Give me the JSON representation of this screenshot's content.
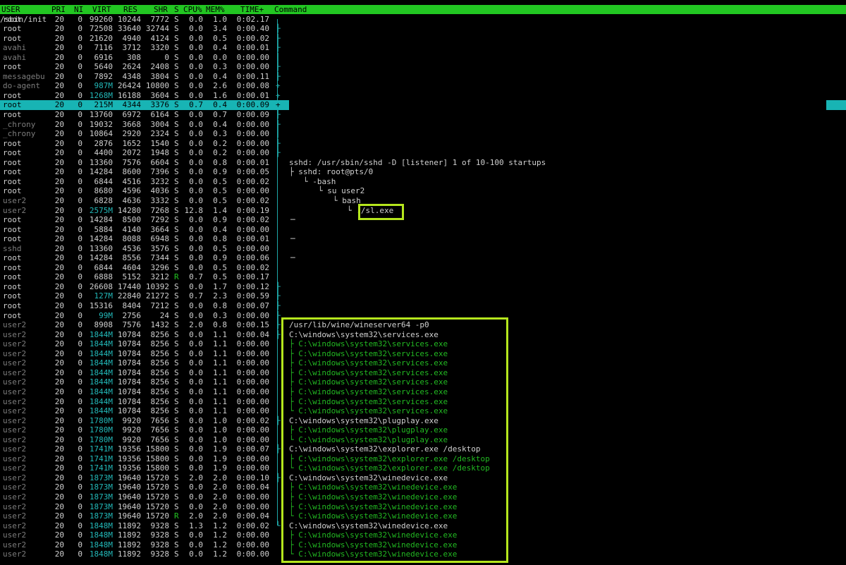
{
  "header": {
    "user": "USER",
    "pri": "PRI",
    "ni": "NI",
    "virt": "VIRT",
    "res": "RES",
    "shr": "SHR",
    "s": "S",
    "cpu": "CPU%",
    "mem": "MEM%",
    "time": "TIME+",
    "command": "Command"
  },
  "rows": [
    {
      "user": "root",
      "pri": "20",
      "ni": "0",
      "virt": "99260",
      "res": "10244",
      "shr": "7772",
      "s": "S",
      "cpu": "0.0",
      "mem": "1.0",
      "time": "0:02.17",
      "tree": "",
      "cmd": "/sbin/init",
      "cmdx": 0
    },
    {
      "user": "root",
      "pri": "20",
      "ni": "0",
      "virt": "72508",
      "res": "33640",
      "shr": "32744",
      "s": "S",
      "cpu": "0.0",
      "mem": "3.4",
      "time": "0:00.40",
      "tree": "├",
      "cmd": "",
      "cmdx": 0
    },
    {
      "user": "root",
      "pri": "20",
      "ni": "0",
      "virt": "21620",
      "res": "4940",
      "shr": "4124",
      "s": "S",
      "cpu": "0.0",
      "mem": "0.5",
      "time": "0:00.02",
      "tree": "├",
      "cmd": "",
      "cmdx": 0
    },
    {
      "user": "avahi",
      "pri": "20",
      "ni": "0",
      "virt": "7116",
      "res": "3712",
      "shr": "3320",
      "s": "S",
      "cpu": "0.0",
      "mem": "0.4",
      "time": "0:00.01",
      "tree": "├",
      "cmd": "",
      "cmdx": 0
    },
    {
      "user": "avahi",
      "pri": "20",
      "ni": "0",
      "virt": "6916",
      "res": "308",
      "shr": "0",
      "s": "S",
      "cpu": "0.0",
      "mem": "0.0",
      "time": "0:00.00",
      "tree": "│",
      "cmd": "",
      "cmdx": 0
    },
    {
      "user": "root",
      "pri": "20",
      "ni": "0",
      "virt": "5640",
      "res": "2624",
      "shr": "2408",
      "s": "S",
      "cpu": "0.0",
      "mem": "0.3",
      "time": "0:00.00",
      "tree": "├",
      "cmd": "",
      "cmdx": 0
    },
    {
      "user": "messagebu",
      "pri": "20",
      "ni": "0",
      "virt": "7892",
      "res": "4348",
      "shr": "3804",
      "s": "S",
      "cpu": "0.0",
      "mem": "0.4",
      "time": "0:00.11",
      "tree": "├",
      "cmd": "",
      "cmdx": 0
    },
    {
      "user": "do-agent",
      "pri": "20",
      "ni": "0",
      "virt": "987M",
      "res": "26424",
      "shr": "10800",
      "s": "S",
      "cpu": "0.0",
      "mem": "2.6",
      "time": "0:00.08",
      "tree": "+",
      "cmd": "",
      "cmdx": 0
    },
    {
      "user": "root",
      "pri": "20",
      "ni": "0",
      "virt": "1268M",
      "res": "16188",
      "shr": "3604",
      "s": "S",
      "cpu": "0.0",
      "mem": "1.6",
      "time": "0:00.01",
      "tree": "+",
      "cmd": "",
      "cmdx": 0
    },
    {
      "user": "root",
      "pri": "20",
      "ni": "0",
      "virt": "215M",
      "res": "4344",
      "shr": "3376",
      "s": "S",
      "cpu": "0.7",
      "mem": "0.4",
      "time": "0:00.09",
      "tree": "+",
      "cmd": "",
      "cmdx": 0,
      "sel": true
    },
    {
      "user": "root",
      "pri": "20",
      "ni": "0",
      "virt": "13760",
      "res": "6972",
      "shr": "6164",
      "s": "S",
      "cpu": "0.0",
      "mem": "0.7",
      "time": "0:00.09",
      "tree": "├",
      "cmd": "",
      "cmdx": 0
    },
    {
      "user": "_chrony",
      "pri": "20",
      "ni": "0",
      "virt": "19032",
      "res": "3668",
      "shr": "3004",
      "s": "S",
      "cpu": "0.0",
      "mem": "0.4",
      "time": "0:00.00",
      "tree": "├",
      "cmd": "",
      "cmdx": 0
    },
    {
      "user": "_chrony",
      "pri": "20",
      "ni": "0",
      "virt": "10864",
      "res": "2920",
      "shr": "2324",
      "s": "S",
      "cpu": "0.0",
      "mem": "0.3",
      "time": "0:00.00",
      "tree": "│",
      "cmd": "",
      "cmdx": 0
    },
    {
      "user": "root",
      "pri": "20",
      "ni": "0",
      "virt": "2876",
      "res": "1652",
      "shr": "1540",
      "s": "S",
      "cpu": "0.0",
      "mem": "0.2",
      "time": "0:00.00",
      "tree": "├",
      "cmd": "",
      "cmdx": 0
    },
    {
      "user": "root",
      "pri": "20",
      "ni": "0",
      "virt": "4400",
      "res": "2072",
      "shr": "1948",
      "s": "S",
      "cpu": "0.0",
      "mem": "0.2",
      "time": "0:00.00",
      "tree": "├",
      "cmd": "",
      "cmdx": 0
    },
    {
      "user": "root",
      "pri": "20",
      "ni": "0",
      "virt": "13360",
      "res": "7576",
      "shr": "6604",
      "s": "S",
      "cpu": "0.0",
      "mem": "0.8",
      "time": "0:00.01",
      "tree": "",
      "cmd": "sshd: /usr/sbin/sshd -D [listener] 1 of 10-100 startups",
      "cmdx": 410
    },
    {
      "user": "root",
      "pri": "20",
      "ni": "0",
      "virt": "14284",
      "res": "8600",
      "shr": "7396",
      "s": "S",
      "cpu": "0.0",
      "mem": "0.9",
      "time": "0:00.05",
      "tree": "",
      "cmd": "├ sshd: root@pts/0",
      "cmdx": 410
    },
    {
      "user": "root",
      "pri": "20",
      "ni": "0",
      "virt": "6844",
      "res": "4516",
      "shr": "3232",
      "s": "S",
      "cpu": "0.0",
      "mem": "0.5",
      "time": "0:00.02",
      "tree": "",
      "cmd": "└ -bash",
      "cmdx": 430
    },
    {
      "user": "root",
      "pri": "20",
      "ni": "0",
      "virt": "8680",
      "res": "4596",
      "shr": "4036",
      "s": "S",
      "cpu": "0.0",
      "mem": "0.5",
      "time": "0:00.00",
      "tree": "",
      "cmd": "└ su user2",
      "cmdx": 451
    },
    {
      "user": "user2",
      "pri": "20",
      "ni": "0",
      "virt": "6828",
      "res": "4636",
      "shr": "3332",
      "s": "S",
      "cpu": "0.0",
      "mem": "0.5",
      "time": "0:00.02",
      "tree": "",
      "cmd": "└ bash",
      "cmdx": 472
    },
    {
      "user": "user2",
      "pri": "20",
      "ni": "0",
      "virt": "2575M",
      "res": "14280",
      "shr": "7268",
      "s": "S",
      "cpu": "12.8",
      "mem": "1.4",
      "time": "0:00.19",
      "tree": "",
      "cmd": "└ ./sl.exe",
      "cmdx": 492
    },
    {
      "user": "root",
      "pri": "20",
      "ni": "0",
      "virt": "14284",
      "res": "8500",
      "shr": "7292",
      "s": "S",
      "cpu": "0.0",
      "mem": "0.9",
      "time": "0:00.02",
      "tree": "",
      "cmd": "─",
      "cmdx": 412
    },
    {
      "user": "root",
      "pri": "20",
      "ni": "0",
      "virt": "5884",
      "res": "4140",
      "shr": "3664",
      "s": "S",
      "cpu": "0.0",
      "mem": "0.4",
      "time": "0:00.00",
      "tree": "",
      "cmd": "",
      "cmdx": 412
    },
    {
      "user": "root",
      "pri": "20",
      "ni": "0",
      "virt": "14284",
      "res": "8088",
      "shr": "6948",
      "s": "S",
      "cpu": "0.0",
      "mem": "0.8",
      "time": "0:00.01",
      "tree": "",
      "cmd": "─",
      "cmdx": 412
    },
    {
      "user": "sshd",
      "pri": "20",
      "ni": "0",
      "virt": "13360",
      "res": "4536",
      "shr": "3576",
      "s": "S",
      "cpu": "0.0",
      "mem": "0.5",
      "time": "0:00.00",
      "tree": "",
      "cmd": "",
      "cmdx": 412
    },
    {
      "user": "root",
      "pri": "20",
      "ni": "0",
      "virt": "14284",
      "res": "8556",
      "shr": "7344",
      "s": "S",
      "cpu": "0.0",
      "mem": "0.9",
      "time": "0:00.06",
      "tree": "",
      "cmd": "─",
      "cmdx": 412
    },
    {
      "user": "root",
      "pri": "20",
      "ni": "0",
      "virt": "6844",
      "res": "4604",
      "shr": "3296",
      "s": "S",
      "cpu": "0.0",
      "mem": "0.5",
      "time": "0:00.02",
      "tree": "",
      "cmd": "",
      "cmdx": 0
    },
    {
      "user": "root",
      "pri": "20",
      "ni": "0",
      "virt": "6888",
      "res": "5152",
      "shr": "3212",
      "s": "R",
      "cpu": "0.7",
      "mem": "0.5",
      "time": "0:00.17",
      "tree": "",
      "cmd": "",
      "cmdx": 0
    },
    {
      "user": "root",
      "pri": "20",
      "ni": "0",
      "virt": "26608",
      "res": "17440",
      "shr": "10392",
      "s": "S",
      "cpu": "0.0",
      "mem": "1.7",
      "time": "0:00.12",
      "tree": "├",
      "cmd": "",
      "cmdx": 0
    },
    {
      "user": "root",
      "pri": "20",
      "ni": "0",
      "virt": "127M",
      "res": "22840",
      "shr": "21272",
      "s": "S",
      "cpu": "0.7",
      "mem": "2.3",
      "time": "0:00.59",
      "tree": "├",
      "cmd": "",
      "cmdx": 0
    },
    {
      "user": "root",
      "pri": "20",
      "ni": "0",
      "virt": "15316",
      "res": "8404",
      "shr": "7212",
      "s": "S",
      "cpu": "0.0",
      "mem": "0.8",
      "time": "0:00.07",
      "tree": "├",
      "cmd": "",
      "cmdx": 0
    },
    {
      "user": "root",
      "pri": "20",
      "ni": "0",
      "virt": "99M",
      "res": "2756",
      "shr": "24",
      "s": "S",
      "cpu": "0.0",
      "mem": "0.3",
      "time": "0:00.00",
      "tree": "├",
      "cmd": "",
      "cmdx": 0
    },
    {
      "user": "user2",
      "pri": "20",
      "ni": "0",
      "virt": "8908",
      "res": "7576",
      "shr": "1432",
      "s": "S",
      "cpu": "2.0",
      "mem": "0.8",
      "time": "0:00.15",
      "tree": "├",
      "cmd": "/usr/lib/wine/wineserver64 -p0",
      "cmdx": 410
    },
    {
      "user": "user2",
      "pri": "20",
      "ni": "0",
      "virt": "1844M",
      "res": "10784",
      "shr": "8256",
      "s": "S",
      "cpu": "0.0",
      "mem": "1.1",
      "time": "0:00.04",
      "tree": "├",
      "cmd": "C:\\windows\\system32\\services.exe",
      "cmdx": 410
    },
    {
      "user": "user2",
      "pri": "20",
      "ni": "0",
      "virt": "1844M",
      "res": "10784",
      "shr": "8256",
      "s": "S",
      "cpu": "0.0",
      "mem": "1.1",
      "time": "0:00.00",
      "tree": "",
      "cmd": "├ C:\\windows\\system32\\services.exe",
      "cmdx": 410,
      "g": true
    },
    {
      "user": "user2",
      "pri": "20",
      "ni": "0",
      "virt": "1844M",
      "res": "10784",
      "shr": "8256",
      "s": "S",
      "cpu": "0.0",
      "mem": "1.1",
      "time": "0:00.00",
      "tree": "",
      "cmd": "├ C:\\windows\\system32\\services.exe",
      "cmdx": 410,
      "g": true
    },
    {
      "user": "user2",
      "pri": "20",
      "ni": "0",
      "virt": "1844M",
      "res": "10784",
      "shr": "8256",
      "s": "S",
      "cpu": "0.0",
      "mem": "1.1",
      "time": "0:00.00",
      "tree": "",
      "cmd": "├ C:\\windows\\system32\\services.exe",
      "cmdx": 410,
      "g": true
    },
    {
      "user": "user2",
      "pri": "20",
      "ni": "0",
      "virt": "1844M",
      "res": "10784",
      "shr": "8256",
      "s": "S",
      "cpu": "0.0",
      "mem": "1.1",
      "time": "0:00.00",
      "tree": "",
      "cmd": "├ C:\\windows\\system32\\services.exe",
      "cmdx": 410,
      "g": true
    },
    {
      "user": "user2",
      "pri": "20",
      "ni": "0",
      "virt": "1844M",
      "res": "10784",
      "shr": "8256",
      "s": "S",
      "cpu": "0.0",
      "mem": "1.1",
      "time": "0:00.00",
      "tree": "",
      "cmd": "├ C:\\windows\\system32\\services.exe",
      "cmdx": 410,
      "g": true
    },
    {
      "user": "user2",
      "pri": "20",
      "ni": "0",
      "virt": "1844M",
      "res": "10784",
      "shr": "8256",
      "s": "S",
      "cpu": "0.0",
      "mem": "1.1",
      "time": "0:00.00",
      "tree": "",
      "cmd": "├ C:\\windows\\system32\\services.exe",
      "cmdx": 410,
      "g": true
    },
    {
      "user": "user2",
      "pri": "20",
      "ni": "0",
      "virt": "1844M",
      "res": "10784",
      "shr": "8256",
      "s": "S",
      "cpu": "0.0",
      "mem": "1.1",
      "time": "0:00.00",
      "tree": "",
      "cmd": "├ C:\\windows\\system32\\services.exe",
      "cmdx": 410,
      "g": true
    },
    {
      "user": "user2",
      "pri": "20",
      "ni": "0",
      "virt": "1844M",
      "res": "10784",
      "shr": "8256",
      "s": "S",
      "cpu": "0.0",
      "mem": "1.1",
      "time": "0:00.00",
      "tree": "",
      "cmd": "└ C:\\windows\\system32\\services.exe",
      "cmdx": 410,
      "g": true
    },
    {
      "user": "user2",
      "pri": "20",
      "ni": "0",
      "virt": "1780M",
      "res": "9920",
      "shr": "7656",
      "s": "S",
      "cpu": "0.0",
      "mem": "1.0",
      "time": "0:00.02",
      "tree": "├",
      "cmd": "C:\\windows\\system32\\plugplay.exe",
      "cmdx": 410
    },
    {
      "user": "user2",
      "pri": "20",
      "ni": "0",
      "virt": "1780M",
      "res": "9920",
      "shr": "7656",
      "s": "S",
      "cpu": "0.0",
      "mem": "1.0",
      "time": "0:00.00",
      "tree": "",
      "cmd": "├ C:\\windows\\system32\\plugplay.exe",
      "cmdx": 410,
      "g": true
    },
    {
      "user": "user2",
      "pri": "20",
      "ni": "0",
      "virt": "1780M",
      "res": "9920",
      "shr": "7656",
      "s": "S",
      "cpu": "0.0",
      "mem": "1.0",
      "time": "0:00.00",
      "tree": "",
      "cmd": "└ C:\\windows\\system32\\plugplay.exe",
      "cmdx": 410,
      "g": true
    },
    {
      "user": "user2",
      "pri": "20",
      "ni": "0",
      "virt": "1741M",
      "res": "19356",
      "shr": "15800",
      "s": "S",
      "cpu": "0.0",
      "mem": "1.9",
      "time": "0:00.07",
      "tree": "├",
      "cmd": "C:\\windows\\system32\\explorer.exe /desktop",
      "cmdx": 410
    },
    {
      "user": "user2",
      "pri": "20",
      "ni": "0",
      "virt": "1741M",
      "res": "19356",
      "shr": "15800",
      "s": "S",
      "cpu": "0.0",
      "mem": "1.9",
      "time": "0:00.00",
      "tree": "",
      "cmd": "├ C:\\windows\\system32\\explorer.exe /desktop",
      "cmdx": 410,
      "g": true
    },
    {
      "user": "user2",
      "pri": "20",
      "ni": "0",
      "virt": "1741M",
      "res": "19356",
      "shr": "15800",
      "s": "S",
      "cpu": "0.0",
      "mem": "1.9",
      "time": "0:00.00",
      "tree": "",
      "cmd": "└ C:\\windows\\system32\\explorer.exe /desktop",
      "cmdx": 410,
      "g": true
    },
    {
      "user": "user2",
      "pri": "20",
      "ni": "0",
      "virt": "1873M",
      "res": "19640",
      "shr": "15720",
      "s": "S",
      "cpu": "2.0",
      "mem": "2.0",
      "time": "0:00.10",
      "tree": "├",
      "cmd": "C:\\windows\\system32\\winedevice.exe",
      "cmdx": 410
    },
    {
      "user": "user2",
      "pri": "20",
      "ni": "0",
      "virt": "1873M",
      "res": "19640",
      "shr": "15720",
      "s": "S",
      "cpu": "0.0",
      "mem": "2.0",
      "time": "0:00.04",
      "tree": "",
      "cmd": "├ C:\\windows\\system32\\winedevice.exe",
      "cmdx": 410,
      "g": true
    },
    {
      "user": "user2",
      "pri": "20",
      "ni": "0",
      "virt": "1873M",
      "res": "19640",
      "shr": "15720",
      "s": "S",
      "cpu": "0.0",
      "mem": "2.0",
      "time": "0:00.00",
      "tree": "",
      "cmd": "├ C:\\windows\\system32\\winedevice.exe",
      "cmdx": 410,
      "g": true
    },
    {
      "user": "user2",
      "pri": "20",
      "ni": "0",
      "virt": "1873M",
      "res": "19640",
      "shr": "15720",
      "s": "S",
      "cpu": "0.0",
      "mem": "2.0",
      "time": "0:00.00",
      "tree": "",
      "cmd": "├ C:\\windows\\system32\\winedevice.exe",
      "cmdx": 410,
      "g": true
    },
    {
      "user": "user2",
      "pri": "20",
      "ni": "0",
      "virt": "1873M",
      "res": "19640",
      "shr": "15720",
      "s": "R",
      "cpu": "2.0",
      "mem": "2.0",
      "time": "0:00.04",
      "tree": "",
      "cmd": "└ C:\\windows\\system32\\winedevice.exe",
      "cmdx": 410,
      "g": true
    },
    {
      "user": "user2",
      "pri": "20",
      "ni": "0",
      "virt": "1848M",
      "res": "11892",
      "shr": "9328",
      "s": "S",
      "cpu": "1.3",
      "mem": "1.2",
      "time": "0:00.02",
      "tree": "└",
      "cmd": "C:\\windows\\system32\\winedevice.exe",
      "cmdx": 410
    },
    {
      "user": "user2",
      "pri": "20",
      "ni": "0",
      "virt": "1848M",
      "res": "11892",
      "shr": "9328",
      "s": "S",
      "cpu": "0.0",
      "mem": "1.2",
      "time": "0:00.00",
      "tree": "",
      "cmd": "├ C:\\windows\\system32\\winedevice.exe",
      "cmdx": 410,
      "g": true
    },
    {
      "user": "user2",
      "pri": "20",
      "ni": "0",
      "virt": "1848M",
      "res": "11892",
      "shr": "9328",
      "s": "S",
      "cpu": "0.0",
      "mem": "1.2",
      "time": "0:00.00",
      "tree": "",
      "cmd": "├ C:\\windows\\system32\\winedevice.exe",
      "cmdx": 410,
      "g": true
    },
    {
      "user": "user2",
      "pri": "20",
      "ni": "0",
      "virt": "1848M",
      "res": "11892",
      "shr": "9328",
      "s": "S",
      "cpu": "0.0",
      "mem": "1.2",
      "time": "0:00.00",
      "tree": "",
      "cmd": "└ C:\\windows\\system32\\winedevice.exe",
      "cmdx": 410,
      "g": true
    }
  ],
  "colors": {
    "header_bg": "#22c622",
    "highlight_box": "#b5e61d",
    "selected_row": "#18b4b4",
    "tree": "#1ea8a8"
  }
}
